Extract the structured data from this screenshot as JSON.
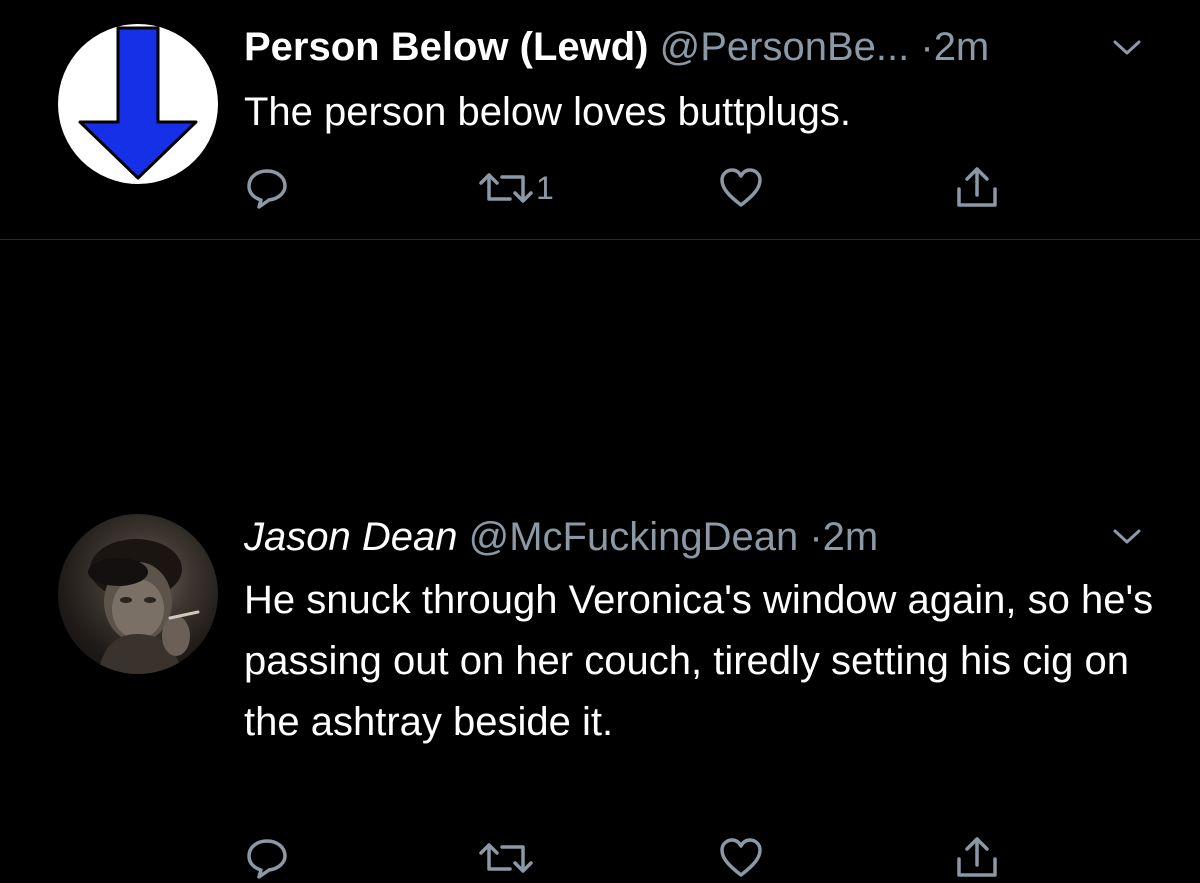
{
  "tweets": [
    {
      "display_name": "Person Below (Lewd)",
      "handle": "@PersonBe...",
      "separator": "·",
      "time": "2m",
      "text": "The person below loves buttplugs.",
      "retweet_count": "1",
      "avatar_icon": "blue-down-arrow-icon"
    },
    {
      "display_name": "Jason Dean",
      "handle": "@McFuckingDean",
      "separator": "·",
      "time": "2m",
      "text": "He snuck through Veronica's window again, so he's passing out on her couch, tiredly setting his cig on the ashtray beside it.",
      "retweet_count": "",
      "avatar_icon": "photo-avatar"
    }
  ],
  "icons": {
    "reply": "comment-bubble-icon",
    "retweet": "retweet-arrows-icon",
    "like": "heart-icon",
    "share": "share-upload-icon",
    "more": "chevron-down-icon"
  },
  "colors": {
    "background": "#000000",
    "text": "#ffffff",
    "secondary": "#8b98a5",
    "divider": "#2a2a2a",
    "avatar_arrow": "#1530e6"
  }
}
